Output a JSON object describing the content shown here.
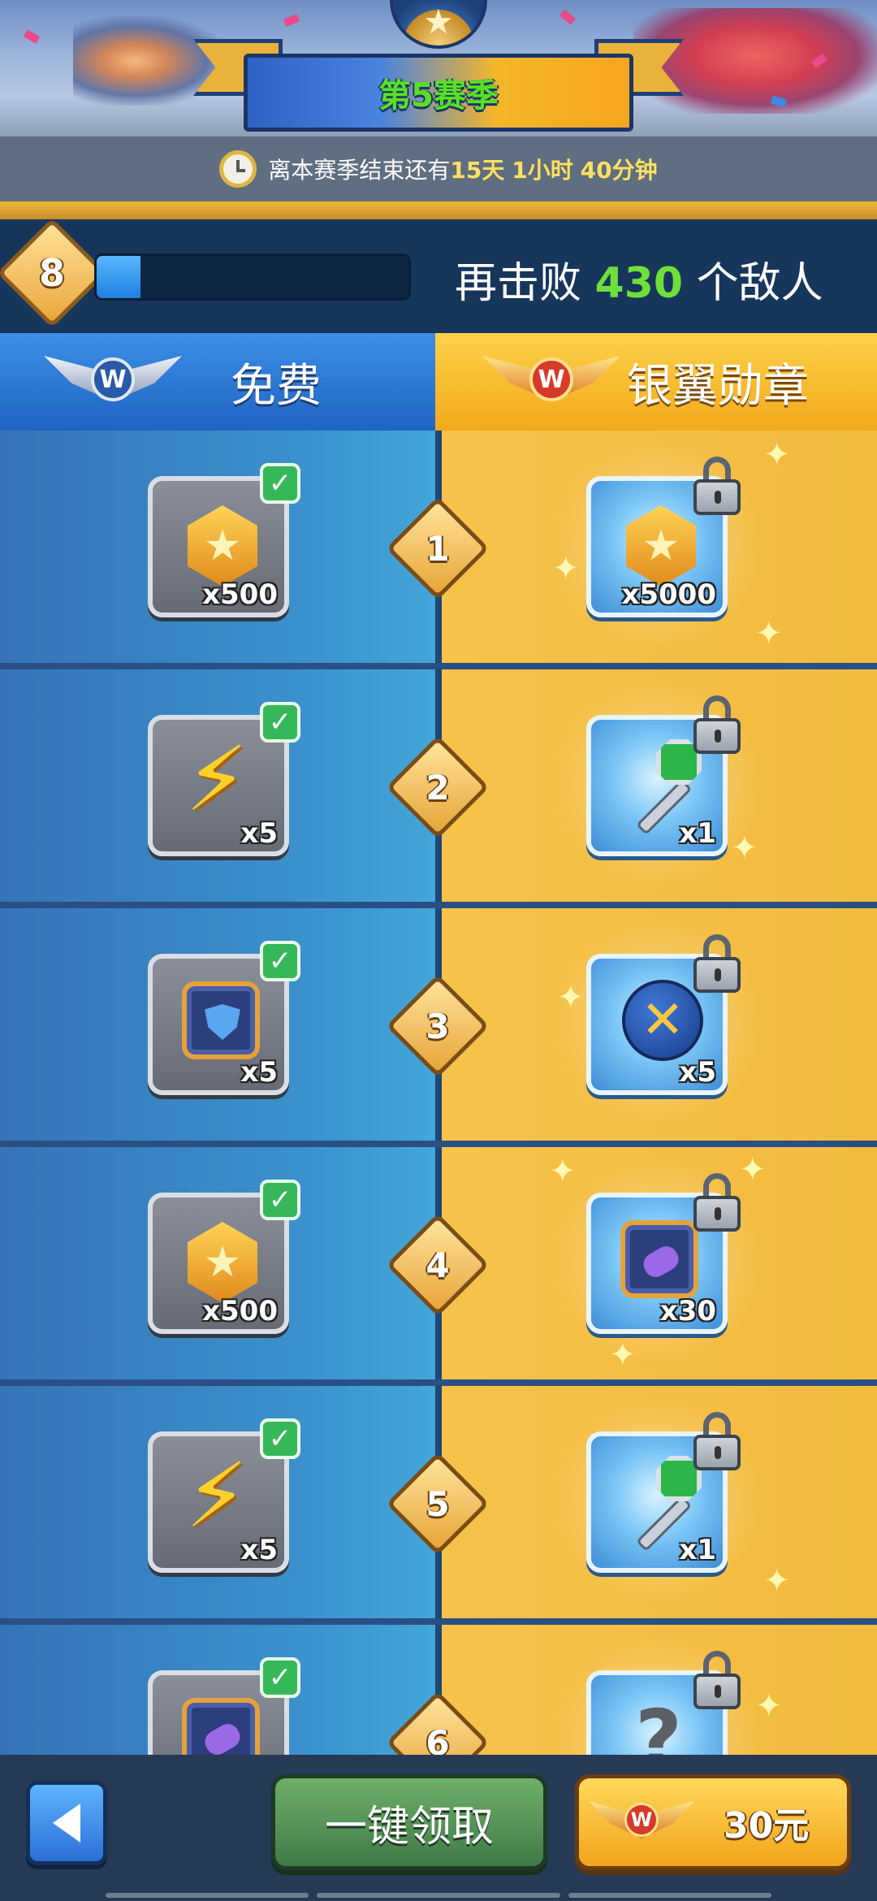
{
  "season": {
    "title": "第5赛季",
    "timer_prefix": "离本赛季结束还有",
    "days": "15天",
    "hours": "1小时",
    "minutes": "40分钟"
  },
  "progress": {
    "level": "8",
    "level_fill": 0.14,
    "enemy_prefix": "再击败",
    "enemy_count": "430",
    "enemy_suffix": "个敌人"
  },
  "tabs": {
    "free": "免费",
    "paid": "银翼勋章"
  },
  "rows": [
    {
      "level": "1",
      "free": {
        "item": "coin-icon",
        "qty": "x500",
        "claimed": true
      },
      "paid": {
        "item": "coin-icon",
        "qty": "x5000",
        "locked": true
      }
    },
    {
      "level": "2",
      "free": {
        "item": "lightning-icon",
        "qty": "x5",
        "claimed": true
      },
      "paid": {
        "item": "green-key-icon",
        "qty": "x1",
        "locked": true
      }
    },
    {
      "level": "3",
      "free": {
        "item": "shield-chip-icon",
        "qty": "x5",
        "claimed": true
      },
      "paid": {
        "item": "bomb-orb-icon",
        "qty": "x5",
        "locked": true
      }
    },
    {
      "level": "4",
      "free": {
        "item": "coin-icon",
        "qty": "x500",
        "claimed": true
      },
      "paid": {
        "item": "purple-chip-icon",
        "qty": "x30",
        "locked": true
      }
    },
    {
      "level": "5",
      "free": {
        "item": "lightning-icon",
        "qty": "x5",
        "claimed": true
      },
      "paid": {
        "item": "green-key-icon",
        "qty": "x1",
        "locked": true
      }
    },
    {
      "level": "6",
      "free": {
        "item": "purple-chip-icon",
        "qty": "",
        "claimed": true
      },
      "paid": {
        "item": "mystery-icon",
        "qty": "",
        "locked": true
      }
    }
  ],
  "bottom": {
    "claim_all": "一键领取",
    "price": "30元"
  },
  "colors": {
    "free_bg": "#3b92cc",
    "paid_bg": "#f2bb3e",
    "accent_green": "#6fe03a",
    "badge_gold": "#e9a63a"
  }
}
